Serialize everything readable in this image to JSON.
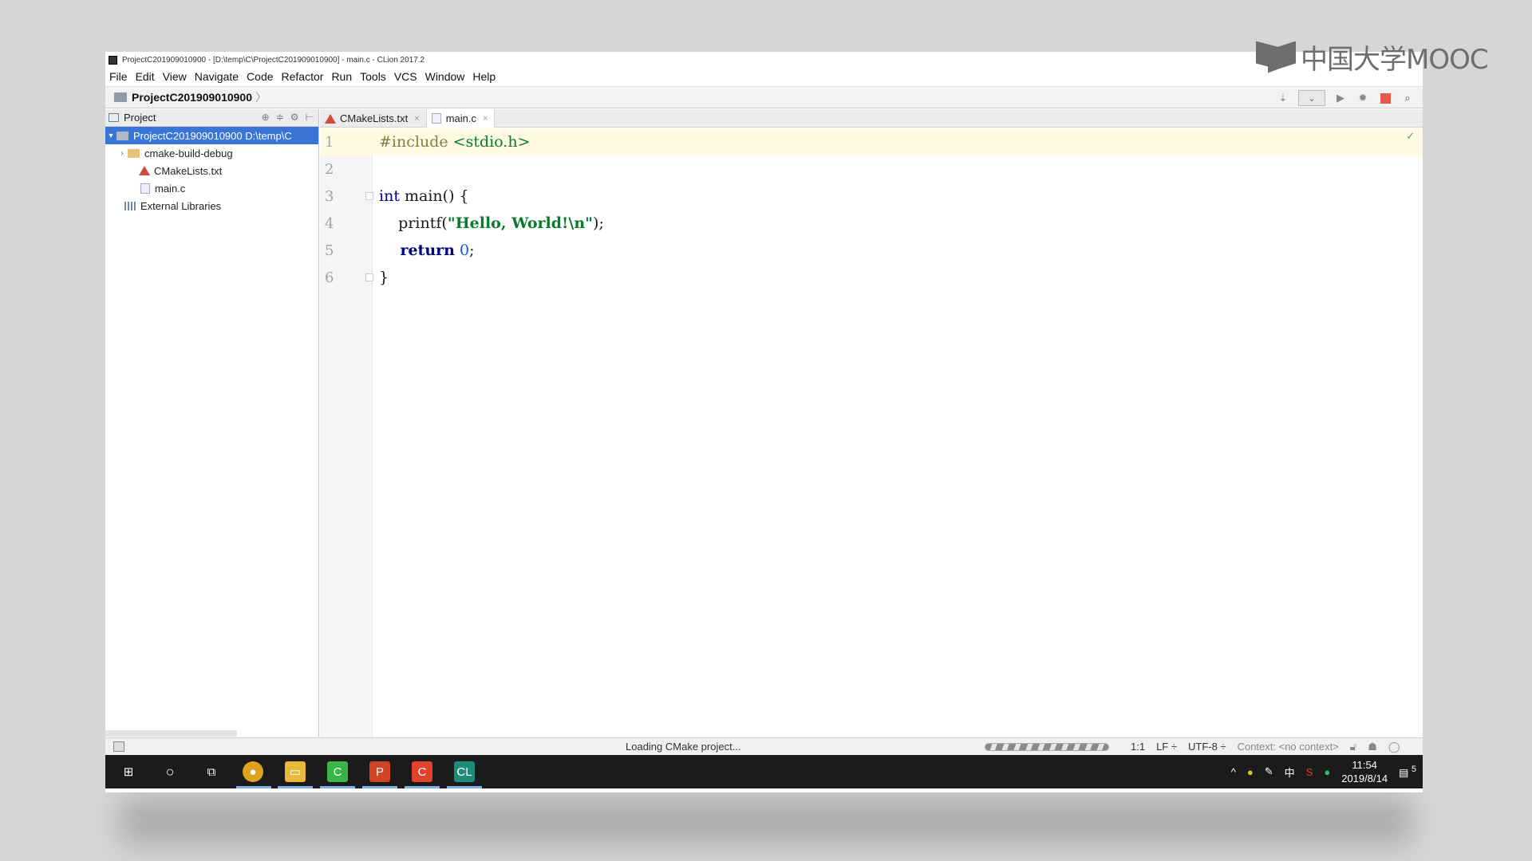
{
  "window": {
    "title": "ProjectC201909010900 - [D:\\temp\\C\\ProjectC201909010900] - main.c - CLion 2017.2"
  },
  "menu": [
    "File",
    "Edit",
    "View",
    "Navigate",
    "Code",
    "Refactor",
    "Run",
    "Tools",
    "VCS",
    "Window",
    "Help"
  ],
  "navbar": {
    "breadcrumb": "ProjectC201909010900",
    "separator": "〉"
  },
  "sidebar": {
    "title": "Project",
    "tree": [
      {
        "label": "ProjectC201909010900   D:\\temp\\C",
        "icon": "folder-icon",
        "selected": true
      },
      {
        "label": "cmake-build-debug",
        "icon": "folder-icon"
      },
      {
        "label": "CMakeLists.txt",
        "icon": "cmake-file-icon"
      },
      {
        "label": "main.c",
        "icon": "c-file-icon"
      },
      {
        "label": "External Libraries",
        "icon": "library-icon"
      }
    ]
  },
  "tabs": [
    {
      "label": "CMakeLists.txt",
      "icon": "cmake-file-icon",
      "active": false,
      "close": "×"
    },
    {
      "label": "main.c",
      "icon": "c-file-icon",
      "active": true,
      "close": "×"
    }
  ],
  "editor": {
    "line_numbers": [
      "1",
      "2",
      "3",
      "4",
      "5",
      "6"
    ],
    "code": {
      "l1_directive": "#include",
      "l1_header": " <stdio.h>",
      "l3_kw": "int",
      "l3_rest": " main() {",
      "l4_fn": "    printf(",
      "l4_str": "\"Hello, World!\\n\"",
      "l4_end": ");",
      "l5_kw": "    return",
      "l5_num": " 0",
      "l5_end": ";",
      "l6": "}"
    }
  },
  "status": {
    "loading": "Loading CMake project...",
    "position": "1:1",
    "line_sep": "LF ÷",
    "encoding": "UTF-8 ÷",
    "context": "Context: <no context>"
  },
  "taskbar": {
    "time": "11:54",
    "date": "2019/8/14",
    "ime": "中",
    "notifications": "5"
  },
  "watermark": "中国大学MOOC",
  "colors": {
    "selection": "#3875d6",
    "current_line": "#fffae3",
    "keyword": "#000080",
    "string": "#0a7a2e"
  }
}
